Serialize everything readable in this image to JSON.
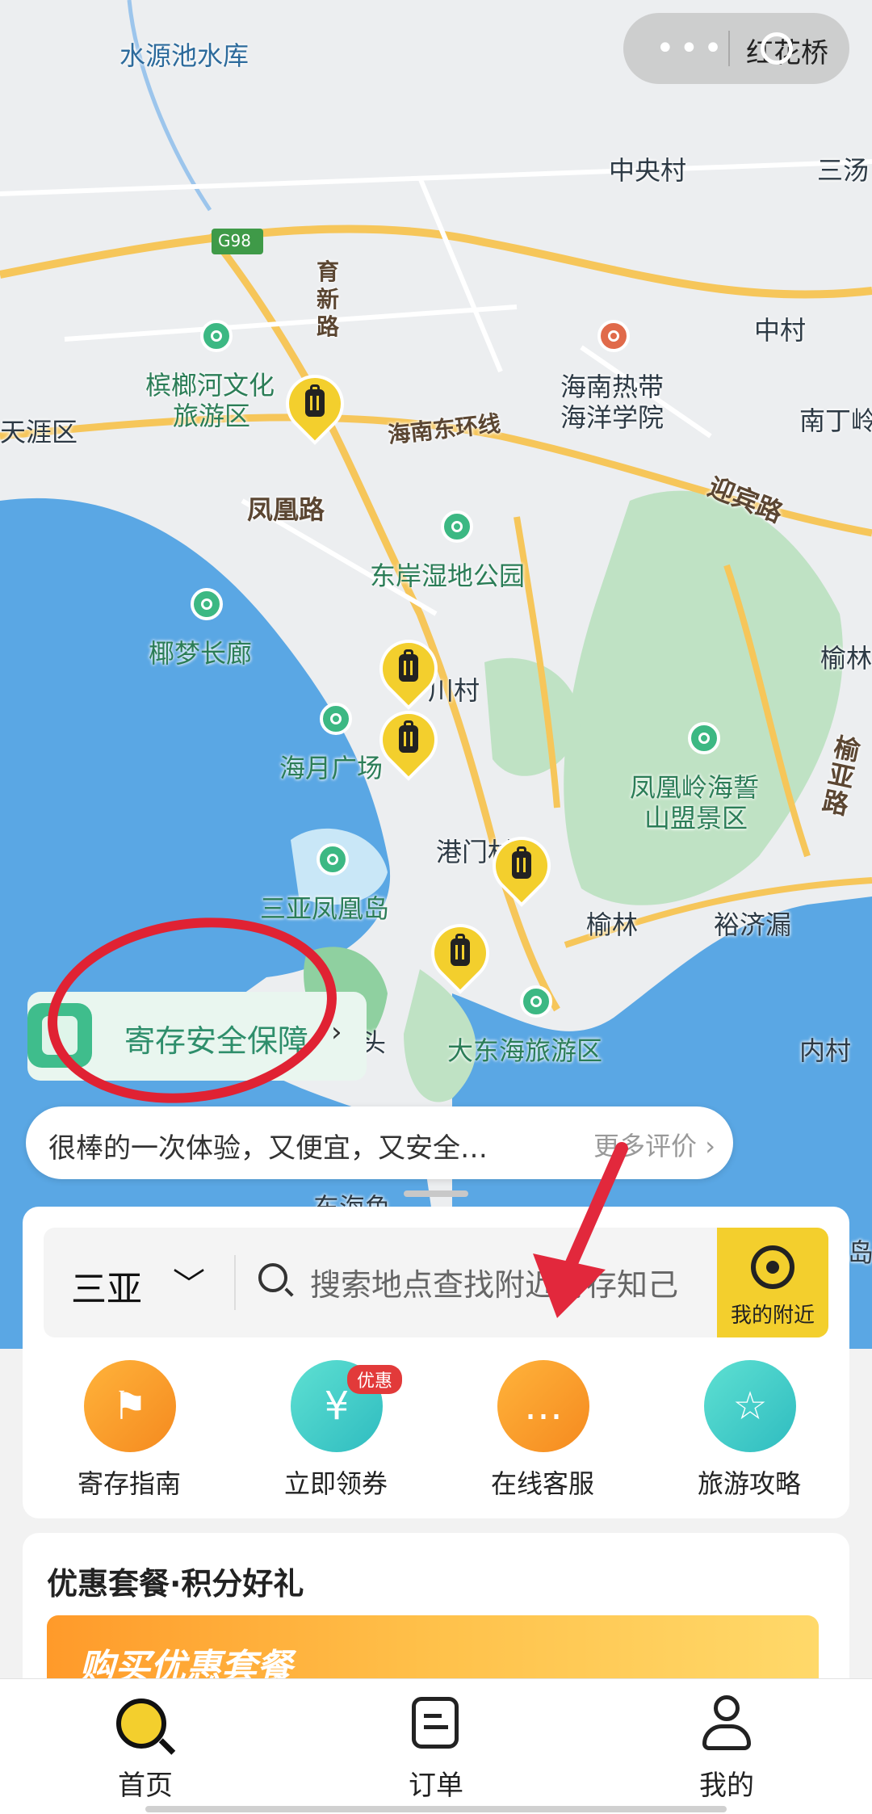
{
  "colors": {
    "accent": "#f3cf2d",
    "safety_green": "#3fbd8c",
    "annotation_red": "#e02233",
    "water": "#5aa7e4",
    "park": "#bfe2c4"
  },
  "top_capsule": {
    "text": "红花桥"
  },
  "map": {
    "labels": {
      "shuiyuanchi": "水源池水库",
      "zhongyangcun": "中央村",
      "santang": "三汤",
      "g98": "G98",
      "yuxinlu": "育新路",
      "zhongcun": "中村",
      "binlang": "槟榔河文化",
      "binlang2": "旅游区",
      "hainan_univ": "海南热带",
      "hainan_univ2": "海洋学院",
      "tianya": "天涯区",
      "huandong": "海南东环线",
      "nanding": "南丁岭",
      "fenghuanglu": "凤凰路",
      "yingbinlu": "迎宾路",
      "donganshidi": "东岸湿地公园",
      "yemeng": "椰梦长廊",
      "chuancun": "川村",
      "yulin": "榆林",
      "haiyue": "海月广场",
      "fenghuangling": "凤凰岭海誓",
      "fenghuangling2": "山盟景区",
      "yuyalu": "榆亚路",
      "gangmen": "港门村",
      "sanya_island": "三亚凤凰岛",
      "yulin2": "榆林",
      "yujilou": "裕济漏",
      "dadonghai": "大东海旅游区",
      "neicun": "内村",
      "tou": "头",
      "donghaiyu": "东海鱼",
      "dao": "岛"
    }
  },
  "safety_banner": {
    "text": "寄存安全保障",
    "arrow": "›"
  },
  "review": {
    "text": "很棒的一次体验，又便宜，又安全…",
    "more": "更多评价 ›"
  },
  "search": {
    "city": "三亚",
    "city_chevron": "﹀",
    "placeholder": "搜索地点查找附近寄存知己",
    "nearby_label": "我的附近"
  },
  "quick_actions": [
    {
      "label": "寄存指南",
      "icon": "signpost-icon",
      "glyph": "⚑"
    },
    {
      "label": "立即领券",
      "icon": "coupon-icon",
      "glyph": "¥",
      "badge": "优惠"
    },
    {
      "label": "在线客服",
      "icon": "chat-icon",
      "glyph": "…"
    },
    {
      "label": "旅游攻略",
      "icon": "guidebook-icon",
      "glyph": "☆"
    }
  ],
  "promo": {
    "title": "优惠套餐·积分好礼",
    "banner_text": "购买优惠套餐"
  },
  "tabs": [
    {
      "label": "首页",
      "icon": "search-home-icon"
    },
    {
      "label": "订单",
      "icon": "order-icon"
    },
    {
      "label": "我的",
      "icon": "profile-icon"
    }
  ]
}
